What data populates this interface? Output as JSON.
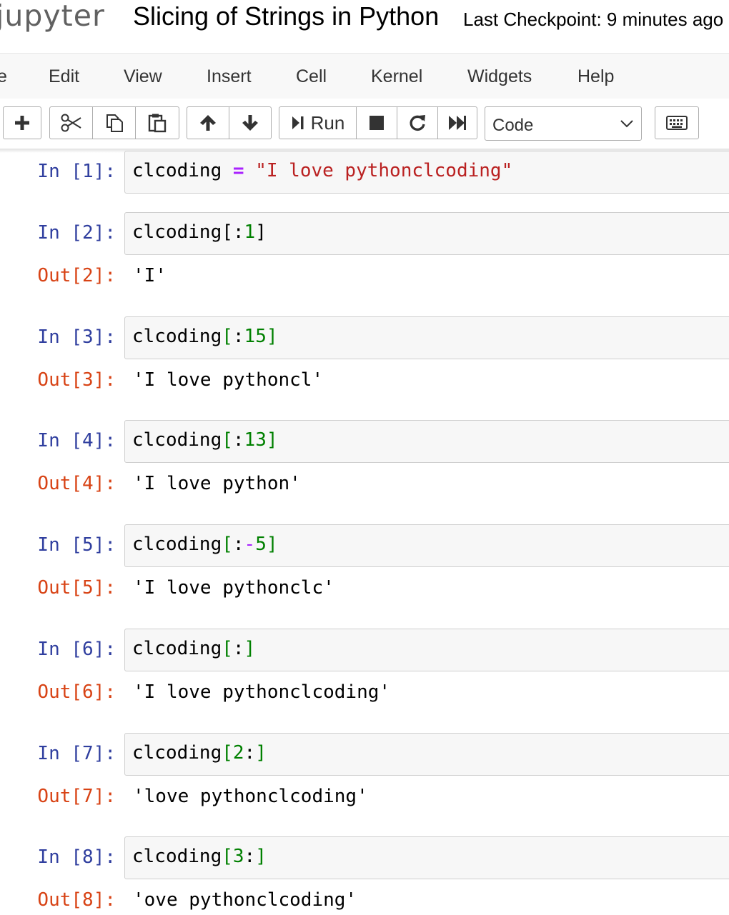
{
  "header": {
    "logo": "jupyter",
    "notebook_title": "Slicing of Strings in Python",
    "checkpoint": "Last Checkpoint: 9 minutes ago"
  },
  "menu": [
    "e",
    "Edit",
    "View",
    "Insert",
    "Cell",
    "Kernel",
    "Widgets",
    "Help"
  ],
  "toolbar": {
    "run_label": "Run",
    "cell_type": "Code",
    "icons": [
      "plus-icon",
      "scissors-icon",
      "copy-icon",
      "paste-icon",
      "arrow-up-icon",
      "arrow-down-icon",
      "run-icon",
      "stop-icon",
      "restart-icon",
      "fast-forward-icon",
      "keyboard-icon"
    ]
  },
  "cells": [
    {
      "in": "In [1]:",
      "code": {
        "var": "clcoding",
        "op": " = ",
        "str": "\"I love pythonclcoding\""
      }
    },
    {
      "in": "In [2]:",
      "out": "Out[2]:",
      "code": {
        "var": "clcoding",
        "open": "[",
        "colon": ":",
        "num": "1",
        "close": "]"
      },
      "result": "'I'"
    },
    {
      "in": "In [3]:",
      "out": "Out[3]:",
      "code": {
        "var": "clcoding",
        "open": "[",
        "colon": ":",
        "num": "15",
        "close": "]"
      },
      "result": "'I love pythoncl'"
    },
    {
      "in": "In [4]:",
      "out": "Out[4]:",
      "code": {
        "var": "clcoding",
        "open": "[",
        "colon": ":",
        "num": "13",
        "close": "]"
      },
      "result": "'I love python'"
    },
    {
      "in": "In [5]:",
      "out": "Out[5]:",
      "code": {
        "var": "clcoding",
        "open": "[",
        "colon": ":",
        "minus": "-",
        "num": "5",
        "close": "]"
      },
      "result": "'I love pythonclc'"
    },
    {
      "in": "In [6]:",
      "out": "Out[6]:",
      "code": {
        "var": "clcoding",
        "open": "[",
        "colon": ":",
        "close": "]"
      },
      "result": "'I love pythonclcoding'"
    },
    {
      "in": "In [7]:",
      "out": "Out[7]:",
      "code": {
        "var": "clcoding",
        "open": "[",
        "num": "2",
        "colon": ":",
        "close": "]"
      },
      "result": "'love pythonclcoding'"
    },
    {
      "in": "In [8]:",
      "out": "Out[8]:",
      "code": {
        "var": "clcoding",
        "open": "[",
        "num": "3",
        "colon": ":",
        "close": "]"
      },
      "result": "'ove pythonclcoding'"
    }
  ]
}
